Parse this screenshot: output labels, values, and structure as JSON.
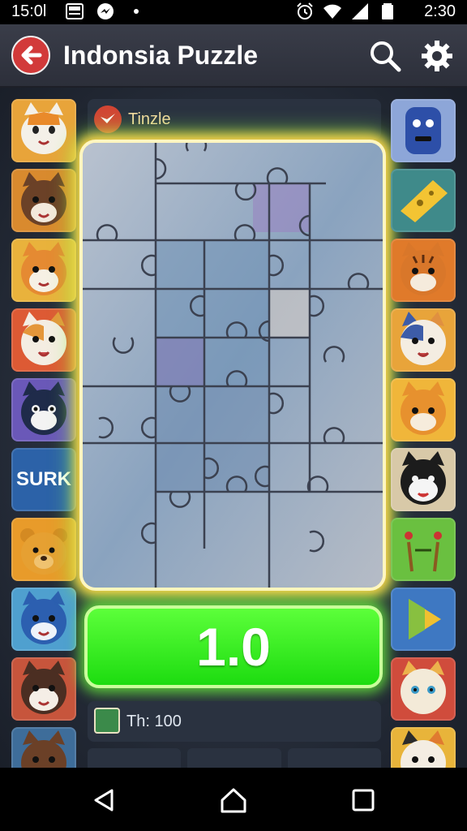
{
  "status_bar": {
    "time_left": "15:0l",
    "time_right": "2:30",
    "icons_left": [
      "image-icon",
      "messenger-icon",
      "dot-icon"
    ],
    "icons_right": [
      "alarm-icon",
      "wifi-icon",
      "signal-icon",
      "battery-icon"
    ]
  },
  "app_bar": {
    "title": "Indonsia Puzzle",
    "icons": [
      "back-arrow-icon",
      "search-icon",
      "gear-icon"
    ]
  },
  "header": {
    "title": "Tinzle",
    "logo": "tinzle-logo-icon"
  },
  "left_tiles": [
    {
      "icon": "orange-cat-icon"
    },
    {
      "icon": "brown-cat-icon"
    },
    {
      "icon": "tabby-cat-icon"
    },
    {
      "icon": "calico-cat-icon"
    },
    {
      "icon": "black-cat-icon"
    },
    {
      "label": "SURK"
    },
    {
      "icon": "yellow-bear-icon"
    },
    {
      "icon": "blue-cat-icon"
    },
    {
      "icon": "brown-white-cat-icon"
    },
    {
      "icon": "dark-brown-cat-icon"
    }
  ],
  "right_tiles": [
    {
      "icon": "blue-robot-icon"
    },
    {
      "icon": "cheese-icon"
    },
    {
      "icon": "tiger-cat-icon"
    },
    {
      "icon": "blue-calico-cat-icon"
    },
    {
      "icon": "orange-tiger-icon"
    },
    {
      "icon": "black-white-cat-icon"
    },
    {
      "icon": "green-creature-icon"
    },
    {
      "icon": "play-icon"
    },
    {
      "icon": "siamese-cat-icon"
    },
    {
      "icon": "calico-cat-icon"
    }
  ],
  "score": {
    "value": "1.0"
  },
  "info": {
    "text": "Th: 100",
    "icon": "thumbnail-icon"
  },
  "nav_bar": {
    "icons": [
      "back-triangle-icon",
      "home-icon",
      "recents-square-icon"
    ]
  },
  "colors": {
    "accent_green": "#1ddc10",
    "glow_yellow": "#ffd34a",
    "back_red": "#d23a3a",
    "header_text": "#f3d9a0"
  }
}
